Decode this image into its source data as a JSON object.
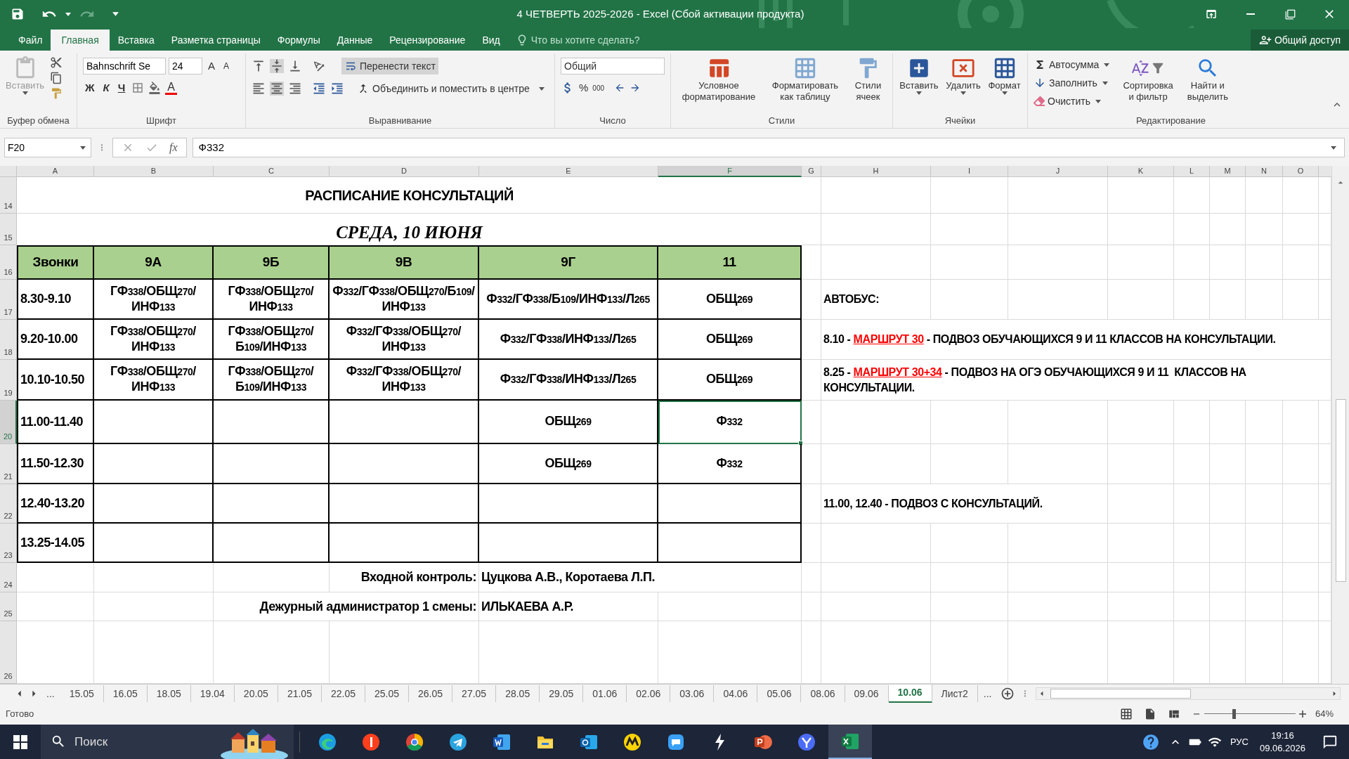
{
  "title_bar": {
    "title": "4 ЧЕТВЕРТЬ 2025-2026 - Excel (Сбой активации продукта)"
  },
  "ribbon_tabs": [
    {
      "label": "Файл",
      "selected": false
    },
    {
      "label": "Главная",
      "selected": true
    },
    {
      "label": "Вставка",
      "selected": false
    },
    {
      "label": "Разметка страницы",
      "selected": false
    },
    {
      "label": "Формулы",
      "selected": false
    },
    {
      "label": "Данные",
      "selected": false
    },
    {
      "label": "Рецензирование",
      "selected": false
    },
    {
      "label": "Вид",
      "selected": false
    }
  ],
  "tell_me": {
    "placeholder": "Что вы хотите сделать?"
  },
  "share": "Общий доступ",
  "clipboard": {
    "paste": "Вставить",
    "group": "Буфер обмена"
  },
  "font": {
    "name": "Bahnschrift Se",
    "size": "24",
    "grow": "A",
    "shrink": "A",
    "bold": "Ж",
    "italic": "К",
    "underline": "Ч",
    "color_letter": "A",
    "group": "Шрифт"
  },
  "alignment": {
    "wrap_text": {
      "label": "Перенести текст",
      "on": true
    },
    "merge": "Объединить и поместить в центре",
    "group": "Выравнивание"
  },
  "number": {
    "format": "Общий",
    "percent": "%",
    "thousands": "000",
    "group": "Число"
  },
  "styles": {
    "buttons": [
      {
        "lines": [
          "Условное",
          "форматирование"
        ]
      },
      {
        "lines": [
          "Форматировать",
          "как таблицу"
        ]
      },
      {
        "lines": [
          "Стили",
          "ячеек"
        ]
      }
    ],
    "group": "Стили"
  },
  "cells": {
    "buttons": [
      "Вставить",
      "Удалить",
      "Формат"
    ],
    "group": "Ячейки"
  },
  "editing": {
    "small": [
      "Автосумма",
      "Заполнить",
      "Очистить"
    ],
    "large": [
      {
        "lines": [
          "Сортировка",
          "и фильтр"
        ]
      },
      {
        "lines": [
          "Найти и",
          "выделить"
        ]
      }
    ],
    "group": "Редактирование"
  },
  "formula_bar": {
    "name_box": "F20",
    "fx": "fx",
    "value": "Ф332"
  },
  "columns": [
    {
      "label": "A",
      "selected": false
    },
    {
      "label": "B",
      "selected": false
    },
    {
      "label": "C",
      "selected": false
    },
    {
      "label": "D",
      "selected": false
    },
    {
      "label": "E",
      "selected": false
    },
    {
      "label": "F",
      "selected": true
    },
    {
      "label": "G",
      "selected": false
    },
    {
      "label": "H",
      "selected": false
    },
    {
      "label": "I",
      "selected": false
    },
    {
      "label": "J",
      "selected": false
    },
    {
      "label": "K",
      "selected": false
    },
    {
      "label": "L",
      "selected": false
    },
    {
      "label": "M",
      "selected": false
    },
    {
      "label": "N",
      "selected": false
    },
    {
      "label": "O",
      "selected": false
    }
  ],
  "rows": [
    {
      "label": "14",
      "selected": false
    },
    {
      "label": "15",
      "selected": false
    },
    {
      "label": "16",
      "selected": false
    },
    {
      "label": "17",
      "selected": false
    },
    {
      "label": "18",
      "selected": false
    },
    {
      "label": "19",
      "selected": false
    },
    {
      "label": "20",
      "selected": true
    },
    {
      "label": "21",
      "selected": false
    },
    {
      "label": "22",
      "selected": false
    },
    {
      "label": "23",
      "selected": false
    },
    {
      "label": "24",
      "selected": false
    },
    {
      "label": "25",
      "selected": false
    },
    {
      "label": "26",
      "selected": false
    }
  ],
  "schedule": {
    "title": "РАСПИСАНИЕ КОНСУЛЬТАЦИЙ",
    "date": "СРЕДА, 10 ИЮНЯ",
    "header": [
      "Звонки",
      "9А",
      "9Б",
      "9В",
      "9Г",
      "11"
    ],
    "rows": [
      {
        "time": "8.30-9.10",
        "cells": [
          {
            "text": "ГФ338/ОБЩ270/ИНФ133",
            "selected": false
          },
          {
            "text": "ГФ338/ОБЩ270/ИНФ133",
            "selected": false
          },
          {
            "text": "Ф332/ГФ338/ОБЩ270/Б109/ИНФ133",
            "selected": false
          },
          {
            "text": "Ф332/ГФ338/Б109/ИНФ133/Л265",
            "selected": false
          },
          {
            "text": "ОБЩ269",
            "selected": false
          }
        ]
      },
      {
        "time": "9.20-10.00",
        "cells": [
          {
            "text": "ГФ338/ОБЩ270/ИНФ133",
            "selected": false
          },
          {
            "text": "ГФ338/ОБЩ270/Б109/ИНФ133",
            "selected": false
          },
          {
            "text": "Ф332/ГФ338/ОБЩ270/ИНФ133",
            "selected": false
          },
          {
            "text": "Ф332/ГФ338/ИНФ133/Л265",
            "selected": false
          },
          {
            "text": "ОБЩ269",
            "selected": false
          }
        ]
      },
      {
        "time": "10.10-10.50",
        "cells": [
          {
            "text": "ГФ338/ОБЩ270/ИНФ133",
            "selected": false
          },
          {
            "text": "ГФ338/ОБЩ270/Б109/ИНФ133",
            "selected": false
          },
          {
            "text": "Ф332/ГФ338/ОБЩ270/ИНФ133",
            "selected": false
          },
          {
            "text": "Ф332/ГФ338/ИНФ133/Л265",
            "selected": false
          },
          {
            "text": "ОБЩ269",
            "selected": false
          }
        ]
      },
      {
        "time": "11.00-11.40",
        "cells": [
          {
            "selected": false
          },
          {
            "selected": false
          },
          {
            "selected": false
          },
          {
            "text": "ОБЩ269",
            "selected": false
          },
          {
            "text": "Ф332",
            "selected": true
          }
        ]
      },
      {
        "time": "11.50-12.30",
        "cells": [
          {
            "selected": false
          },
          {
            "selected": false
          },
          {
            "selected": false
          },
          {
            "text": "ОБЩ269",
            "selected": false
          },
          {
            "text": "Ф332",
            "selected": false
          }
        ]
      },
      {
        "time": "12.40-13.20",
        "cells": [
          {
            "selected": false
          },
          {
            "selected": false
          },
          {
            "selected": false
          },
          {
            "selected": false
          },
          {
            "selected": false
          }
        ]
      },
      {
        "time": "13.25-14.05",
        "cells": [
          {
            "selected": false
          },
          {
            "selected": false
          },
          {
            "selected": false
          },
          {
            "selected": false
          },
          {
            "selected": false
          }
        ]
      }
    ]
  },
  "signatures": [
    {
      "label": "Входной контроль:",
      "value": "Цуцкова А.В., Коротаева Л.П."
    },
    {
      "label": "Дежурный администратор 1 смены:",
      "value": "ИЛЬКАЕВА А.Р."
    }
  ],
  "notes": [
    {
      "segments": [
        {
          "text": "АВТОБУС:",
          "kind": "plain"
        }
      ]
    },
    {
      "segments": [
        {
          "text": "8.10 - ",
          "kind": "plain"
        },
        {
          "text": "МАРШРУТ 30",
          "kind": "route"
        },
        {
          "text": " - ПОДВОЗ ОБУЧАЮЩИХСЯ 9 И 11 КЛАССОВ НА КОНСУЛЬТАЦИИ.",
          "kind": "plain"
        }
      ]
    },
    {
      "segments": [
        {
          "text": "8.25 - ",
          "kind": "plain"
        },
        {
          "text": "МАРШРУТ 30+34",
          "kind": "route"
        },
        {
          "text": " - ПОДВОЗ НА ОГЭ ОБУЧАЮЩИХСЯ 9 И 11  КЛАССОВ НА КОНСУЛЬТАЦИИ.",
          "kind": "plain"
        }
      ]
    },
    {
      "segments": [
        {
          "text": "11.00, 12.40 - ПОДВОЗ С КОНСУЛЬТАЦИЙ.",
          "kind": "plain"
        }
      ]
    }
  ],
  "sheet_tabs": {
    "overflow_left": "...",
    "overflow_right": "...",
    "tabs": [
      {
        "label": "15.05",
        "selected": false
      },
      {
        "label": "16.05",
        "selected": false
      },
      {
        "label": "18.05",
        "selected": false
      },
      {
        "label": "19.04",
        "selected": false
      },
      {
        "label": "20.05",
        "selected": false
      },
      {
        "label": "21.05",
        "selected": false
      },
      {
        "label": "22.05",
        "selected": false
      },
      {
        "label": "25.05",
        "selected": false
      },
      {
        "label": "26.05",
        "selected": false
      },
      {
        "label": "27.05",
        "selected": false
      },
      {
        "label": "28.05",
        "selected": false
      },
      {
        "label": "29.05",
        "selected": false
      },
      {
        "label": "01.06",
        "selected": false
      },
      {
        "label": "02.06",
        "selected": false
      },
      {
        "label": "03.06",
        "selected": false
      },
      {
        "label": "04.06",
        "selected": false
      },
      {
        "label": "05.06",
        "selected": false
      },
      {
        "label": "08.06",
        "selected": false
      },
      {
        "label": "09.06",
        "selected": false
      },
      {
        "label": "10.06",
        "selected": true
      },
      {
        "label": "Лист2",
        "selected": false
      }
    ]
  },
  "status": {
    "text": "Готово",
    "zoom": {
      "level": 0.32,
      "reading": "64%"
    }
  },
  "taskbar": {
    "search": {
      "placeholder": "Поиск"
    },
    "apps": [
      {
        "kind": "edge",
        "active": false
      },
      {
        "kind": "yandex",
        "active": false
      },
      {
        "kind": "chrome",
        "active": false
      },
      {
        "kind": "telegram",
        "active": false
      },
      {
        "kind": "word",
        "active": false
      },
      {
        "kind": "folder",
        "active": false
      },
      {
        "kind": "outlook",
        "active": false
      },
      {
        "kind": "market",
        "active": false
      },
      {
        "kind": "chat",
        "active": false
      },
      {
        "kind": "bolt",
        "active": false
      },
      {
        "kind": "powerpoint",
        "active": false
      },
      {
        "kind": "ybrowser",
        "active": false
      },
      {
        "kind": "excel",
        "active": true
      }
    ],
    "lang": "РУС",
    "time": "19:16",
    "date": "09.06.2026"
  }
}
